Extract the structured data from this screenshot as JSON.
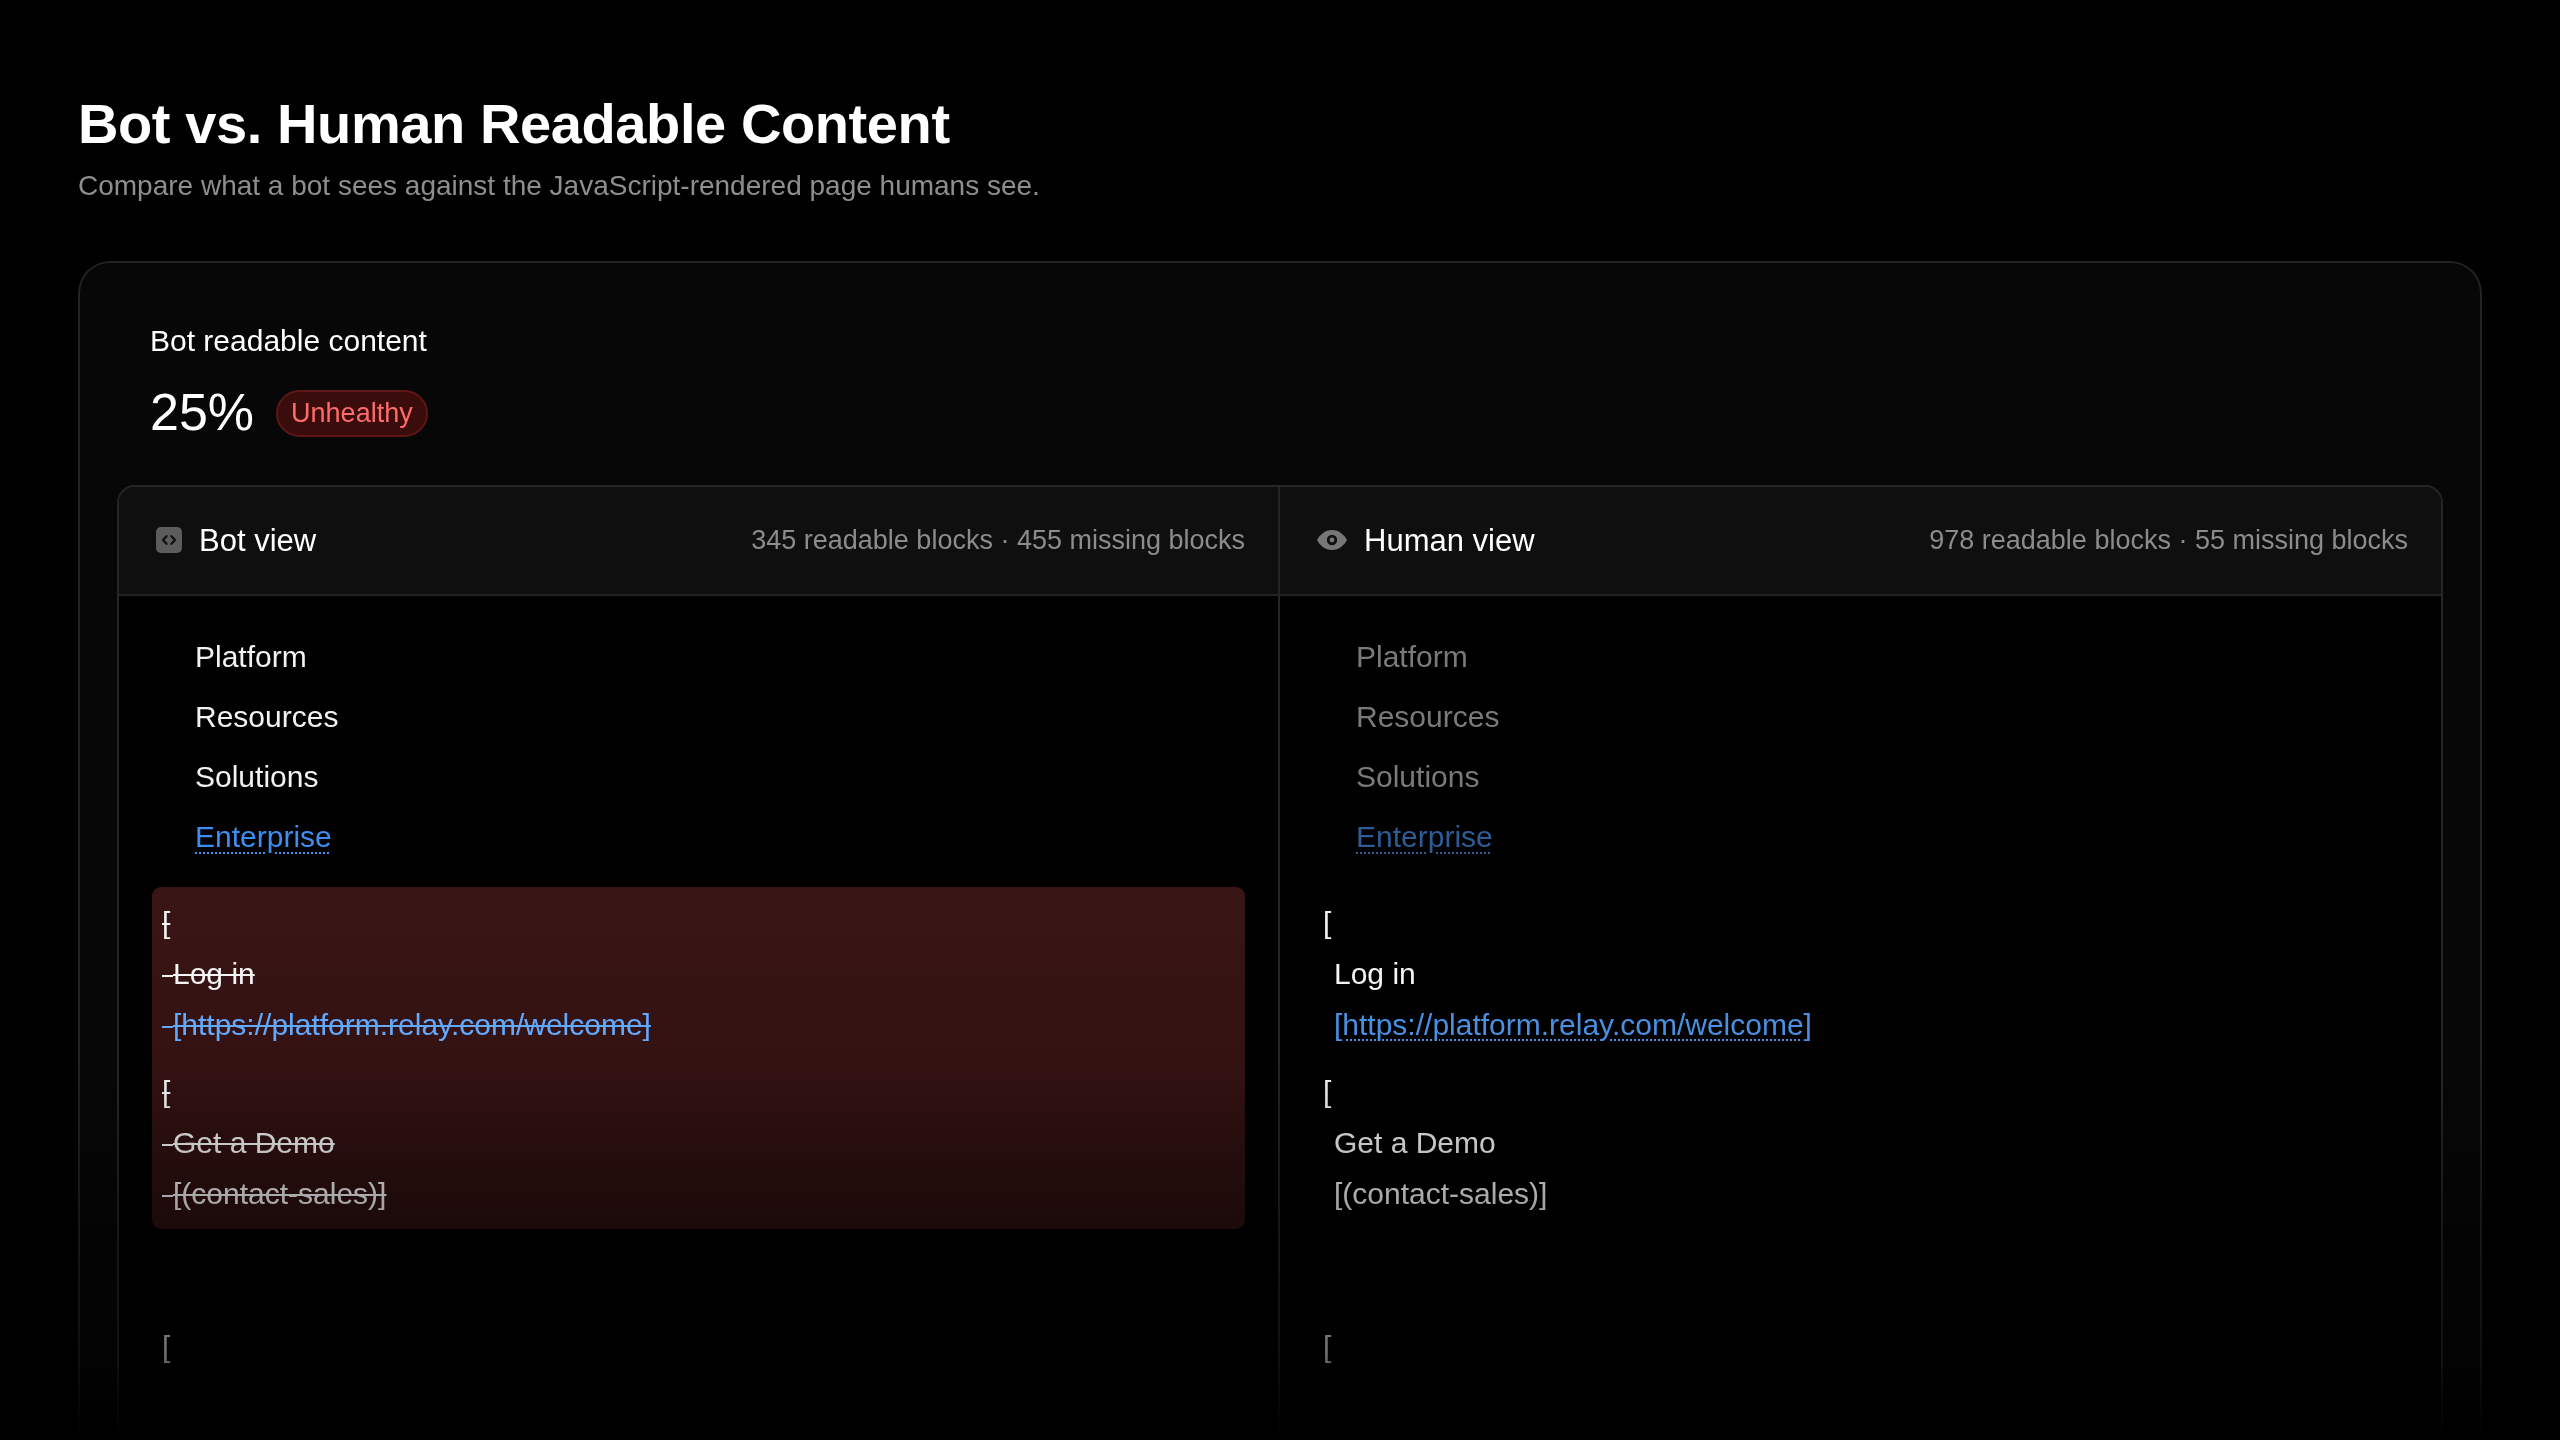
{
  "header": {
    "title": "Bot vs. Human Readable Content",
    "subtitle": "Compare what a bot sees against the JavaScript-rendered page humans see."
  },
  "summary": {
    "label": "Bot readable content",
    "value": "25%",
    "status": {
      "label": "Unhealthy",
      "kind": "unhealthy"
    }
  },
  "panels": [
    {
      "kind": "bot",
      "title": "Bot view",
      "stats": "345 readable blocks · 455 missing blocks",
      "nav": {
        "dimmed": false,
        "items": [
          {
            "text": "Platform",
            "kind": "text"
          },
          {
            "text": "Resources",
            "kind": "text"
          },
          {
            "text": "Solutions",
            "kind": "text"
          },
          {
            "text": "Enterprise",
            "kind": "link"
          }
        ]
      },
      "block": {
        "missing": true,
        "groups": [
          {
            "lines": [
              {
                "text": "[",
                "kind": "bracket"
              },
              {
                "text": "Log in",
                "kind": "text"
              },
              {
                "text": "[https://platform.relay.com/welcome]",
                "kind": "link"
              }
            ]
          },
          {
            "lines": [
              {
                "text": "[",
                "kind": "bracket"
              },
              {
                "text": "Get a Demo",
                "kind": "text"
              },
              {
                "text": "[(contact-sales)]",
                "kind": "text"
              }
            ]
          }
        ]
      },
      "trailing": "["
    },
    {
      "kind": "human",
      "title": "Human view",
      "stats": "978 readable blocks · 55 missing blocks",
      "nav": {
        "dimmed": true,
        "items": [
          {
            "text": "Platform",
            "kind": "text"
          },
          {
            "text": "Resources",
            "kind": "text"
          },
          {
            "text": "Solutions",
            "kind": "text"
          },
          {
            "text": "Enterprise",
            "kind": "link"
          }
        ]
      },
      "block": {
        "missing": false,
        "groups": [
          {
            "lines": [
              {
                "text": "[",
                "kind": "bracket"
              },
              {
                "text": "Log in",
                "kind": "text"
              },
              {
                "text": "[https://platform.relay.com/welcome]",
                "kind": "link"
              }
            ]
          },
          {
            "lines": [
              {
                "text": "[",
                "kind": "bracket"
              },
              {
                "text": "Get a Demo",
                "kind": "text"
              },
              {
                "text": "[(contact-sales)]",
                "kind": "text"
              }
            ]
          }
        ]
      },
      "trailing": "["
    }
  ]
}
